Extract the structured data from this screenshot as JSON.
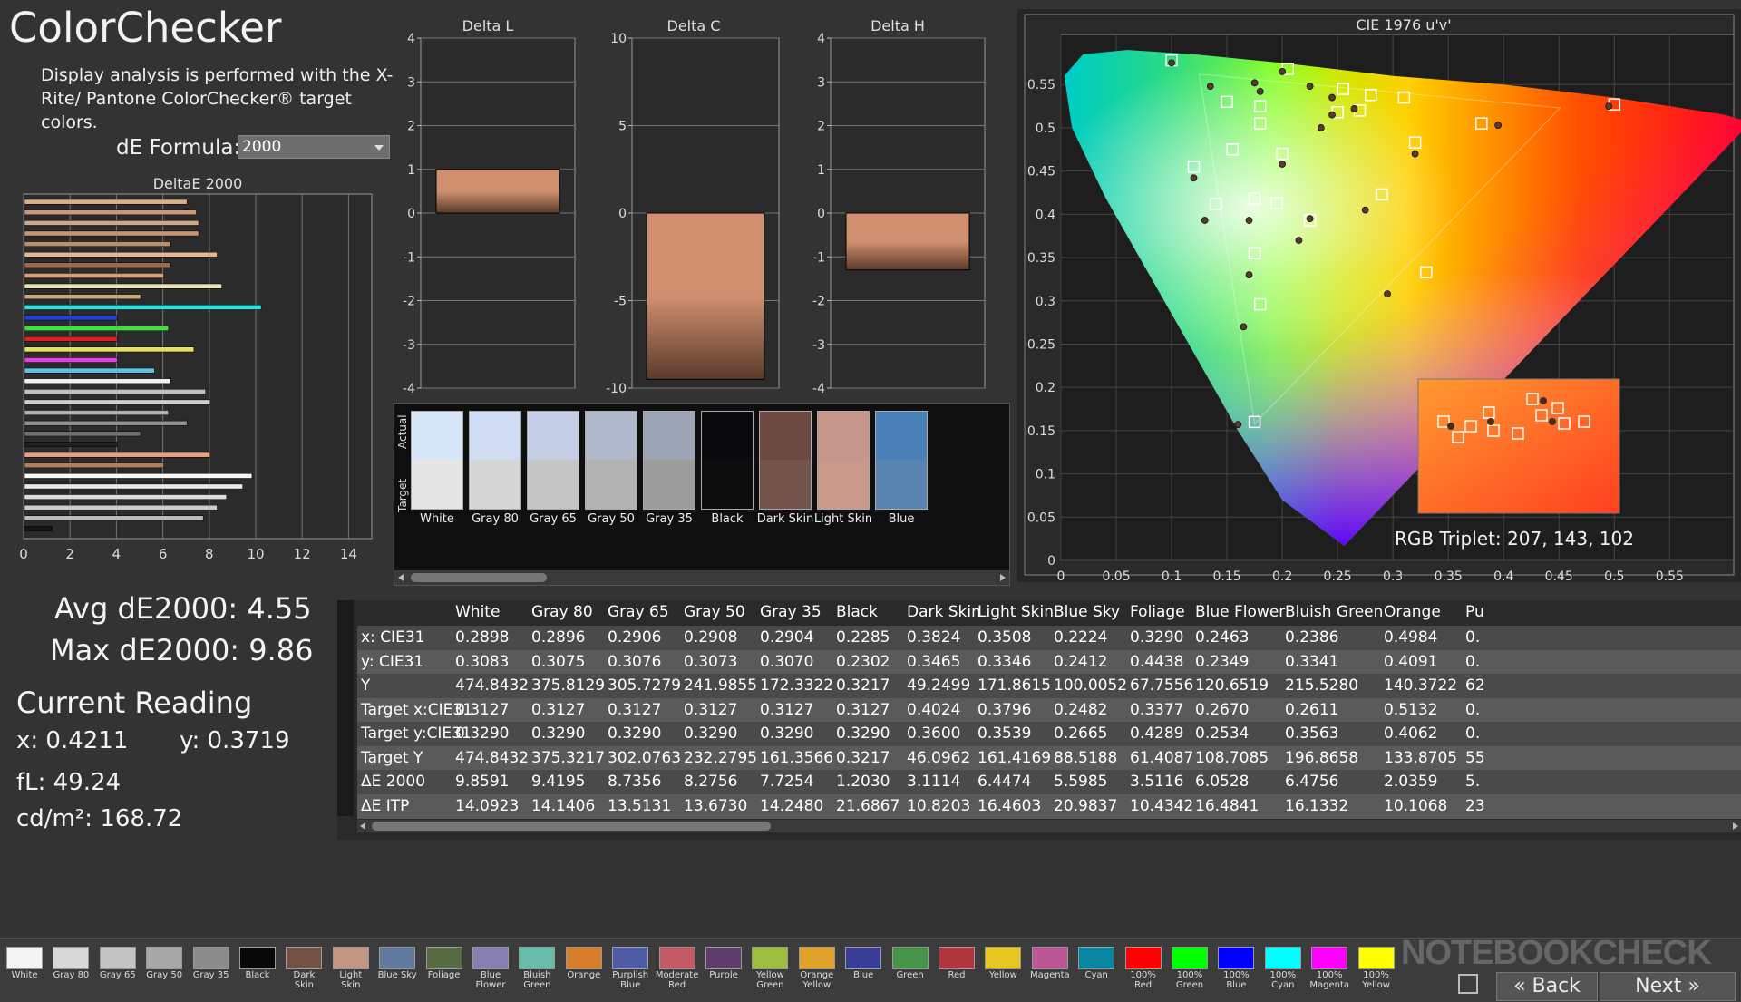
{
  "app": {
    "title": "ColorChecker",
    "description": "Display analysis is performed with the X-Rite/ Pantone ColorChecker® target colors.",
    "de_formula_label": "dE Formula:",
    "de_formula_value": "2000"
  },
  "charts": {
    "deltae_title": "DeltaE 2000",
    "deltae_ticks": [
      "0",
      "2",
      "4",
      "6",
      "8",
      "10",
      "12",
      "14"
    ],
    "deltae_values": [
      7.0,
      7.4,
      7.5,
      7.5,
      6.3,
      8.3,
      6.3,
      6.0,
      8.5,
      5.0,
      10.2,
      4.0,
      6.2,
      4.0,
      7.3,
      4.0,
      5.6,
      6.3,
      7.8,
      8.0,
      6.2,
      7.0,
      5.0,
      4.0,
      8.0,
      6.0,
      9.8,
      9.4,
      8.7,
      8.3,
      7.7,
      1.2
    ],
    "deltae_colors": [
      "#d8b08a",
      "#c89878",
      "#d0a888",
      "#c89470",
      "#b89070",
      "#e8b490",
      "#a06848",
      "#d0a078",
      "#e8e0b8",
      "#c8a878",
      "#30e0e0",
      "#2040d0",
      "#40e040",
      "#e02020",
      "#e8e060",
      "#e040e0",
      "#60c0e0",
      "#f0f0f0",
      "#c0c0c0",
      "#d0d0d0",
      "#b0b0b0",
      "#909090",
      "#707070",
      "#202020",
      "#e8a080",
      "#b08060",
      "#f8f8f8",
      "#e8e8e8",
      "#dddddd",
      "#cccccc",
      "#bbbbbb",
      "#151515"
    ],
    "delta_l": {
      "title": "Delta L",
      "ticks": [
        "4",
        "3",
        "2",
        "1",
        "0",
        "-1",
        "-2",
        "-3",
        "-4"
      ],
      "value": 1.0
    },
    "delta_c": {
      "title": "Delta C",
      "ticks": [
        "10",
        "5",
        "0",
        "-5",
        "-10"
      ],
      "value": -9.5
    },
    "delta_h": {
      "title": "Delta H",
      "ticks": [
        "4",
        "3",
        "2",
        "1",
        "0",
        "-1",
        "-2",
        "-3",
        "-4"
      ],
      "value": -1.3
    },
    "bar_color": "#d09070"
  },
  "swatches": {
    "actual_label": "Actual",
    "target_label": "Target",
    "items": [
      {
        "name": "White",
        "actual": "#d8e6fa",
        "target": "#e6e6e6"
      },
      {
        "name": "Gray 80",
        "actual": "#d0dcf2",
        "target": "#d6d6d6"
      },
      {
        "name": "Gray 65",
        "actual": "#c4cee4",
        "target": "#c6c6c6"
      },
      {
        "name": "Gray 50",
        "actual": "#b0b8cc",
        "target": "#b2b2b2"
      },
      {
        "name": "Gray 35",
        "actual": "#9ca4b6",
        "target": "#9c9c9c"
      },
      {
        "name": "Black",
        "actual": "#0a0a0e",
        "target": "#0c0c0c"
      },
      {
        "name": "Dark Skin",
        "actual": "#6c4a42",
        "target": "#74544a"
      },
      {
        "name": "Light Skin",
        "actual": "#c4968c",
        "target": "#c8988a"
      },
      {
        "name": "Blue",
        "actual": "#4a80b8",
        "target": "#5884b0"
      }
    ]
  },
  "cie": {
    "title": "CIE 1976 u'v'",
    "x_ticks": [
      "0",
      "0.05",
      "0.1",
      "0.15",
      "0.2",
      "0.25",
      "0.3",
      "0.35",
      "0.4",
      "0.45",
      "0.5",
      "0.55"
    ],
    "y_ticks": [
      "0.55",
      "0.5",
      "0.45",
      "0.4",
      "0.35",
      "0.3",
      "0.25",
      "0.2",
      "0.15",
      "0.1",
      "0.05",
      "0"
    ],
    "triplet": "RGB Triplet: 207, 143, 102"
  },
  "cie_points": {
    "targets": [
      [
        0.1,
        0.578
      ],
      [
        0.205,
        0.568
      ],
      [
        0.15,
        0.53
      ],
      [
        0.18,
        0.525
      ],
      [
        0.18,
        0.505
      ],
      [
        0.255,
        0.545
      ],
      [
        0.31,
        0.535
      ],
      [
        0.28,
        0.538
      ],
      [
        0.25,
        0.518
      ],
      [
        0.27,
        0.52
      ],
      [
        0.38,
        0.505
      ],
      [
        0.5,
        0.527
      ],
      [
        0.32,
        0.483
      ],
      [
        0.155,
        0.475
      ],
      [
        0.2,
        0.47
      ],
      [
        0.12,
        0.455
      ],
      [
        0.175,
        0.418
      ],
      [
        0.195,
        0.413
      ],
      [
        0.14,
        0.412
      ],
      [
        0.29,
        0.423
      ],
      [
        0.225,
        0.393
      ],
      [
        0.175,
        0.355
      ],
      [
        0.33,
        0.333
      ],
      [
        0.18,
        0.296
      ],
      [
        0.175,
        0.16
      ]
    ],
    "measured": [
      [
        0.1,
        0.575
      ],
      [
        0.135,
        0.548
      ],
      [
        0.175,
        0.552
      ],
      [
        0.18,
        0.542
      ],
      [
        0.2,
        0.565
      ],
      [
        0.225,
        0.548
      ],
      [
        0.245,
        0.535
      ],
      [
        0.265,
        0.522
      ],
      [
        0.245,
        0.515
      ],
      [
        0.235,
        0.5
      ],
      [
        0.2,
        0.458
      ],
      [
        0.12,
        0.442
      ],
      [
        0.13,
        0.393
      ],
      [
        0.17,
        0.393
      ],
      [
        0.215,
        0.37
      ],
      [
        0.225,
        0.395
      ],
      [
        0.275,
        0.405
      ],
      [
        0.32,
        0.47
      ],
      [
        0.395,
        0.503
      ],
      [
        0.495,
        0.525
      ],
      [
        0.17,
        0.33
      ],
      [
        0.165,
        0.27
      ],
      [
        0.295,
        0.308
      ],
      [
        0.16,
        0.157
      ]
    ]
  },
  "stats": {
    "avg": "Avg dE2000: 4.55",
    "max": "Max dE2000: 9.86",
    "current_reading": "Current Reading",
    "x": "x: 0.4211",
    "y": "y: 0.3719",
    "fl": "fL: 49.24",
    "cdm2": "cd/m²: 168.72"
  },
  "table": {
    "headers": [
      "",
      "White",
      "Gray 80",
      "Gray 65",
      "Gray 50",
      "Gray 35",
      "Black",
      "Dark Skin",
      "Light Skin",
      "Blue Sky",
      "Foliage",
      "Blue Flower",
      "Bluish Green",
      "Orange",
      "Pu"
    ],
    "rows": [
      [
        "x: CIE31",
        "0.2898",
        "0.2896",
        "0.2906",
        "0.2908",
        "0.2904",
        "0.2285",
        "0.3824",
        "0.3508",
        "0.2224",
        "0.3290",
        "0.2463",
        "0.2386",
        "0.4984",
        "0."
      ],
      [
        "y: CIE31",
        "0.3083",
        "0.3075",
        "0.3076",
        "0.3073",
        "0.3070",
        "0.2302",
        "0.3465",
        "0.3346",
        "0.2412",
        "0.4438",
        "0.2349",
        "0.3341",
        "0.4091",
        "0."
      ],
      [
        "Y",
        "474.8432",
        "375.8129",
        "305.7279",
        "241.9855",
        "172.3322",
        "0.3217",
        "49.2499",
        "171.8615",
        "100.0052",
        "67.7556",
        "120.6519",
        "215.5280",
        "140.3722",
        "62"
      ],
      [
        "Target x:CIE31",
        "0.3127",
        "0.3127",
        "0.3127",
        "0.3127",
        "0.3127",
        "0.3127",
        "0.4024",
        "0.3796",
        "0.2482",
        "0.3377",
        "0.2670",
        "0.2611",
        "0.5132",
        "0."
      ],
      [
        "Target y:CIE31",
        "0.3290",
        "0.3290",
        "0.3290",
        "0.3290",
        "0.3290",
        "0.3290",
        "0.3600",
        "0.3539",
        "0.2665",
        "0.4289",
        "0.2534",
        "0.3563",
        "0.4062",
        "0."
      ],
      [
        "Target Y",
        "474.8432",
        "375.3217",
        "302.0763",
        "232.2795",
        "161.3566",
        "0.3217",
        "46.0962",
        "161.4169",
        "88.5188",
        "61.4087",
        "108.7085",
        "196.8658",
        "133.8705",
        "55"
      ],
      [
        "ΔE 2000",
        "9.8591",
        "9.4195",
        "8.7356",
        "8.2756",
        "7.7254",
        "1.2030",
        "3.1114",
        "6.4474",
        "5.5985",
        "3.5116",
        "6.0528",
        "6.4756",
        "2.0359",
        "5."
      ],
      [
        "ΔE ITP",
        "14.0923",
        "14.1406",
        "13.5131",
        "13.6730",
        "14.2480",
        "21.6867",
        "10.8203",
        "16.4603",
        "20.9837",
        "10.4342",
        "16.4841",
        "16.1332",
        "10.1068",
        "23"
      ]
    ]
  },
  "legend": [
    {
      "label": "White",
      "color": "#f4f4f4"
    },
    {
      "label": "Gray 80",
      "color": "#d8d8d8"
    },
    {
      "label": "Gray 65",
      "color": "#c4c4c4"
    },
    {
      "label": "Gray 50",
      "color": "#a8a8a8"
    },
    {
      "label": "Gray 35",
      "color": "#8c8c8c"
    },
    {
      "label": "Black",
      "color": "#080808"
    },
    {
      "label": "Dark Skin",
      "color": "#735244"
    },
    {
      "label": "Light Skin",
      "color": "#c29682"
    },
    {
      "label": "Blue Sky",
      "color": "#627a9d"
    },
    {
      "label": "Foliage",
      "color": "#576c43"
    },
    {
      "label": "Blue Flower",
      "color": "#8580b1"
    },
    {
      "label": "Bluish Green",
      "color": "#67bdaa"
    },
    {
      "label": "Orange",
      "color": "#d67e2c"
    },
    {
      "label": "Purplish Blue",
      "color": "#505ba6"
    },
    {
      "label": "Moderate Red",
      "color": "#c15a63"
    },
    {
      "label": "Purple",
      "color": "#5e3c6c"
    },
    {
      "label": "Yellow Green",
      "color": "#9dbc40"
    },
    {
      "label": "Orange Yellow",
      "color": "#e0a32e"
    },
    {
      "label": "Blue",
      "color": "#383d96"
    },
    {
      "label": "Green",
      "color": "#469449"
    },
    {
      "label": "Red",
      "color": "#af363c"
    },
    {
      "label": "Yellow",
      "color": "#e7c71f"
    },
    {
      "label": "Magenta",
      "color": "#bb5695"
    },
    {
      "label": "Cyan",
      "color": "#0885a1"
    },
    {
      "label": "100% Red",
      "color": "#ff0000"
    },
    {
      "label": "100% Green",
      "color": "#00ff00"
    },
    {
      "label": "100% Blue",
      "color": "#0000ff"
    },
    {
      "label": "100% Cyan",
      "color": "#00ffff"
    },
    {
      "label": "100% Magenta",
      "color": "#ff00ff"
    },
    {
      "label": "100% Yellow",
      "color": "#ffff00"
    }
  ],
  "nav": {
    "back": "Back",
    "next": "Next"
  },
  "watermark": "NOTEBOOKCHECK"
}
